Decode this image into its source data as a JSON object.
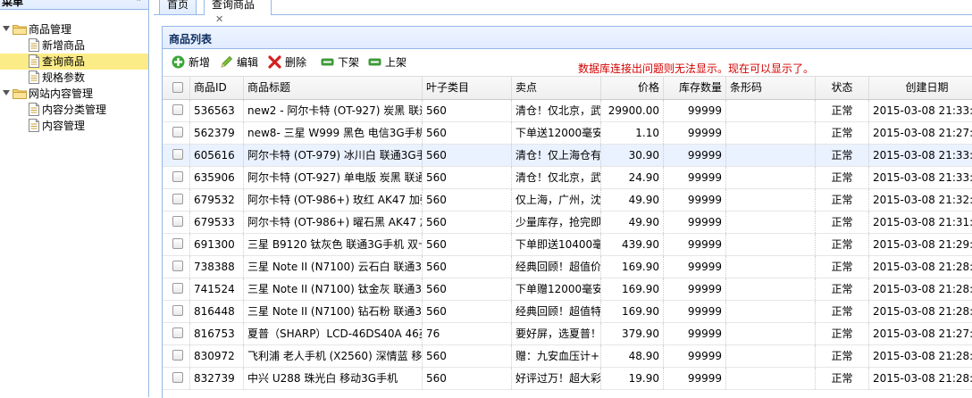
{
  "sidebar": {
    "title": "菜单",
    "tree": [
      {
        "label": "商品管理",
        "kind": "folder",
        "level": 0
      },
      {
        "label": "新增商品",
        "kind": "file",
        "level": 1
      },
      {
        "label": "查询商品",
        "kind": "file",
        "level": 1,
        "selected": true
      },
      {
        "label": "规格参数",
        "kind": "file",
        "level": 1
      },
      {
        "label": "网站内容管理",
        "kind": "folder",
        "level": 0
      },
      {
        "label": "内容分类管理",
        "kind": "file",
        "level": 1
      },
      {
        "label": "内容管理",
        "kind": "file",
        "level": 1
      }
    ]
  },
  "tabs": [
    {
      "label": "首页",
      "closable": false
    },
    {
      "label": "查询商品",
      "closable": true,
      "active": true
    }
  ],
  "panel": {
    "title": "商品列表"
  },
  "toolbar": {
    "buttons": [
      "新增",
      "编辑",
      "删除",
      "下架",
      "上架"
    ],
    "notice": "数据库连接出问题则无法显示。现在可以显示了。"
  },
  "grid": {
    "columns": [
      "商品ID",
      "商品标题",
      "叶子类目",
      "卖点",
      "价格",
      "库存数量",
      "条形码",
      "状态",
      "创建日期"
    ],
    "rows": [
      {
        "id": "536563",
        "title": "new2 - 阿尔卡特 (OT-927) 炭黑 联通",
        "cat": "560",
        "sell": "清仓！仅北京，武",
        "price": "29900.00",
        "stock": "99999",
        "barcode": "",
        "status": "正常",
        "created": "2015-03-08 21:33:1"
      },
      {
        "id": "562379",
        "title": "new8- 三星 W999 黑色 电信3G手机",
        "cat": "560",
        "sell": "下单送12000毫安",
        "price": "1.10",
        "stock": "99999",
        "barcode": "",
        "status": "正常",
        "created": "2015-03-08 21:27:5"
      },
      {
        "id": "605616",
        "title": "阿尔卡特 (OT-979) 冰川白 联通3G手",
        "cat": "560",
        "sell": "清仓！仅上海仓有",
        "price": "30.90",
        "stock": "99999",
        "barcode": "",
        "status": "正常",
        "created": "2015-03-08 21:33:1"
      },
      {
        "id": "635906",
        "title": "阿尔卡特 (OT-927) 单电版 炭黑 联通",
        "cat": "560",
        "sell": "清仓！仅北京，武",
        "price": "24.90",
        "stock": "99999",
        "barcode": "",
        "status": "正常",
        "created": "2015-03-08 21:33:1"
      },
      {
        "id": "679532",
        "title": "阿尔卡特 (OT-986+) 玫红 AK47 加强",
        "cat": "560",
        "sell": "仅上海，广州，沈",
        "price": "49.90",
        "stock": "99999",
        "barcode": "",
        "status": "正常",
        "created": "2015-03-08 21:32:3"
      },
      {
        "id": "679533",
        "title": "阿尔卡特 (OT-986+) 曜石黑 AK47 加",
        "cat": "560",
        "sell": "少量库存，抢完即",
        "price": "49.90",
        "stock": "99999",
        "barcode": "",
        "status": "正常",
        "created": "2015-03-08 21:31:3"
      },
      {
        "id": "691300",
        "title": "三星 B9120 钛灰色 联通3G手机 双卡",
        "cat": "560",
        "sell": "下单即送10400毫",
        "price": "439.90",
        "stock": "99999",
        "barcode": "",
        "status": "正常",
        "created": "2015-03-08 21:29:2"
      },
      {
        "id": "738388",
        "title": "三星 Note II (N7100) 云石白 联通3G",
        "cat": "560",
        "sell": "经典回顾！超值价",
        "price": "169.90",
        "stock": "99999",
        "barcode": "",
        "status": "正常",
        "created": "2015-03-08 21:28:3"
      },
      {
        "id": "741524",
        "title": "三星 Note II (N7100) 钛金灰 联通3G",
        "cat": "560",
        "sell": "下单赠12000毫安",
        "price": "169.90",
        "stock": "99999",
        "barcode": "",
        "status": "正常",
        "created": "2015-03-08 21:28:3"
      },
      {
        "id": "816448",
        "title": "三星 Note II (N7100) 钻石粉 联通3G",
        "cat": "560",
        "sell": "经典回顾！超值特",
        "price": "169.90",
        "stock": "99999",
        "barcode": "",
        "status": "正常",
        "created": "2015-03-08 21:28:4"
      },
      {
        "id": "816753",
        "title": "夏普（SHARP）LCD-46DS40A 46英",
        "cat": "76",
        "sell": "要好屏，选夏普！",
        "price": "379.90",
        "stock": "99999",
        "barcode": "",
        "status": "正常",
        "created": "2015-03-08 21:27:3"
      },
      {
        "id": "830972",
        "title": "飞利浦 老人手机 (X2560) 深情蓝 移动",
        "cat": "560",
        "sell": "赠：九安血压计+8",
        "price": "48.90",
        "stock": "99999",
        "barcode": "",
        "status": "正常",
        "created": "2015-03-08 21:28:4"
      },
      {
        "id": "832739",
        "title": "中兴 U288 珠光白 移动3G手机",
        "cat": "560",
        "sell": "好评过万！超大彩",
        "price": "19.90",
        "stock": "99999",
        "barcode": "",
        "status": "正常",
        "created": "2015-03-08 21:28:4"
      }
    ]
  },
  "colors": {
    "border": "#95b8e7",
    "header_bg": "#e0ecff",
    "selected_tree": "#fbec88",
    "notice": "#d40000",
    "row_highlight": "#eaf2ff"
  }
}
